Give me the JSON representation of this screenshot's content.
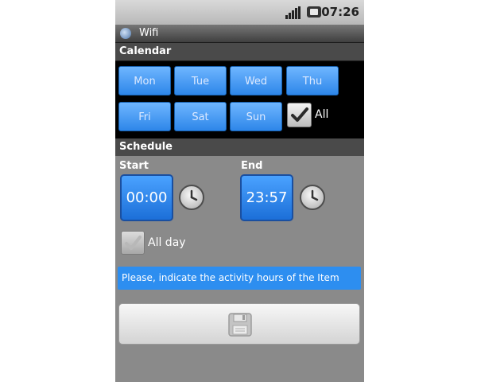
{
  "status_bar": {
    "time": "07:26",
    "signal_icon": "signal-icon",
    "battery_icon": "battery-icon"
  },
  "title_bar": {
    "title": "Wifi",
    "icon": "app-icon"
  },
  "calendar": {
    "header": "Calendar",
    "days": [
      "Mon",
      "Tue",
      "Wed",
      "Thu",
      "Fri",
      "Sat",
      "Sun"
    ],
    "all_label": "All",
    "all_checked": true
  },
  "schedule": {
    "header": "Schedule",
    "start_label": "Start",
    "start_time": "00:00",
    "end_label": "End",
    "end_time": "23:57",
    "allday_label": "All day",
    "allday_checked": true,
    "info_text": "Please, indicate the activity hours of the Item",
    "save_icon": "save-icon"
  }
}
